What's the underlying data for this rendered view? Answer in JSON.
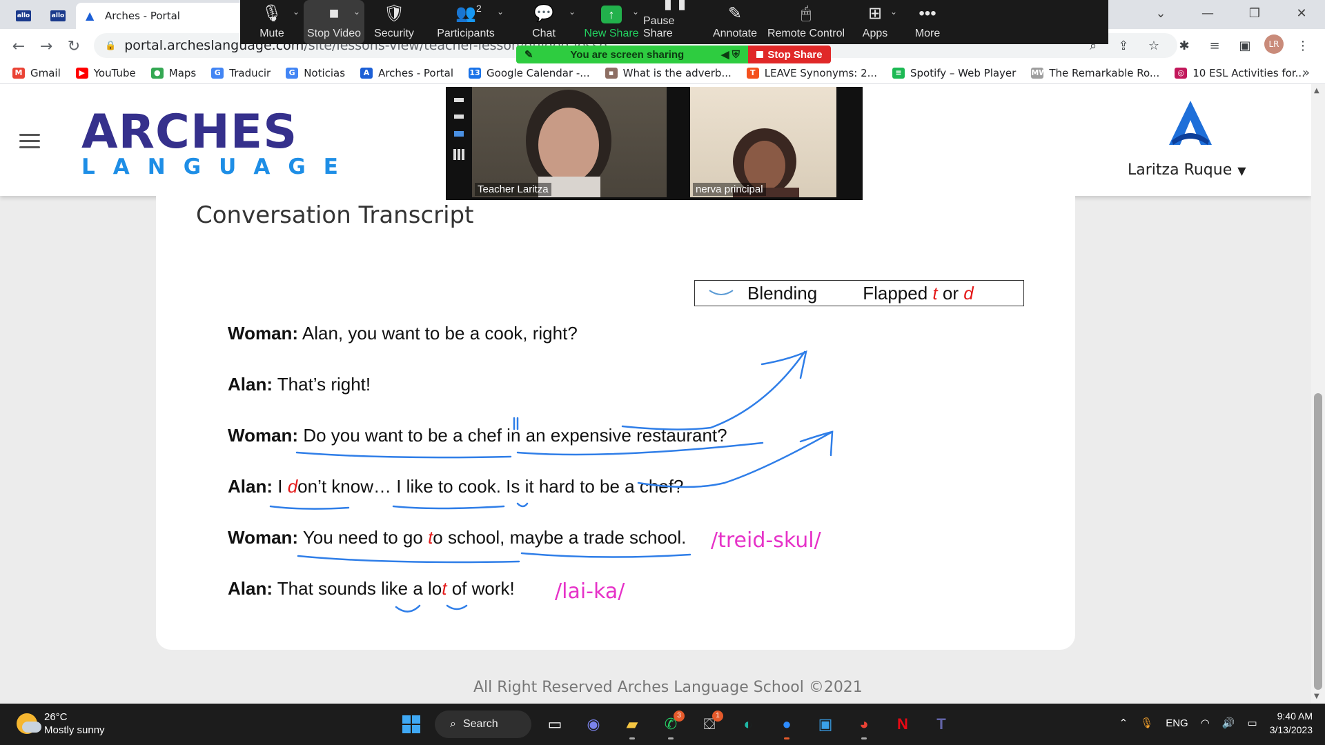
{
  "browser": {
    "tab_title": "Arches - Portal",
    "url_host": "portal.archeslanguage.com",
    "url_path": "/site/lessons-view/teacher-lesson/guided-lesso"
  },
  "bookmarks": [
    {
      "label": "Gmail",
      "color": "#ea4335",
      "glyph": "M"
    },
    {
      "label": "YouTube",
      "color": "#ff0000",
      "glyph": "▶"
    },
    {
      "label": "Maps",
      "color": "#34a853",
      "glyph": "●"
    },
    {
      "label": "Traducir",
      "color": "#4285f4",
      "glyph": "G"
    },
    {
      "label": "Noticias",
      "color": "#4285f4",
      "glyph": "G"
    },
    {
      "label": "Arches - Portal",
      "color": "#1c5fd6",
      "glyph": "A"
    },
    {
      "label": "Google Calendar -...",
      "color": "#1a73e8",
      "glyph": "13"
    },
    {
      "label": "What is the adverb...",
      "color": "#8d6e63",
      "glyph": "▪"
    },
    {
      "label": "LEAVE Synonyms: 2...",
      "color": "#f4511e",
      "glyph": "T"
    },
    {
      "label": "Spotify – Web Player",
      "color": "#1db954",
      "glyph": "≡"
    },
    {
      "label": "The Remarkable Ro...",
      "color": "#9e9e9e",
      "glyph": "MW"
    },
    {
      "label": "10 ESL Activities for...",
      "color": "#c2185b",
      "glyph": "◎"
    }
  ],
  "zoom": {
    "buttons": [
      {
        "label": "Mute",
        "icon": "🎙",
        "caret": true
      },
      {
        "label": "Stop Video",
        "icon": "■",
        "caret": true,
        "active": true
      },
      {
        "label": "Security",
        "icon": "🛡",
        "caret": false
      },
      {
        "label": "Participants",
        "icon": "👥",
        "caret": true,
        "badge": "2"
      },
      {
        "label": "Chat",
        "icon": "💬",
        "caret": true
      },
      {
        "label": "New Share",
        "icon": "↑",
        "caret": true,
        "green": true
      },
      {
        "label": "Pause Share",
        "icon": "❚❚",
        "caret": false
      },
      {
        "label": "Annotate",
        "icon": "✎",
        "caret": false
      },
      {
        "label": "Remote Control",
        "icon": "🖱",
        "caret": false
      },
      {
        "label": "Apps",
        "icon": "⊞",
        "caret": true
      },
      {
        "label": "More",
        "icon": "•••",
        "caret": false
      }
    ],
    "sharing_label": "You are screen sharing",
    "stop_share_label": "Stop Share",
    "participants": [
      {
        "name": "Teacher Laritza"
      },
      {
        "name": "nerva principal"
      }
    ]
  },
  "site": {
    "logo_top": "ARCHES",
    "logo_bottom": "LANGUAGE",
    "user_name": "Laritza Ruque",
    "section_title": "Conversation Transcript",
    "legend_blending": "Blending",
    "legend_flapped": "Flapped",
    "legend_t": "t",
    "legend_or": "or",
    "legend_d": "d",
    "footer": "All Right Reserved Arches Language School ©2021"
  },
  "transcript": [
    {
      "speaker": "Woman:",
      "text": "Alan, you want to be a cook, right?"
    },
    {
      "speaker": "Alan:",
      "text": "That’s right!"
    },
    {
      "speaker": "Woman:",
      "text": "Do you want to be a chef in an expensive restaurant?"
    },
    {
      "speaker": "Alan:",
      "text_pre": "I ",
      "flap": "d",
      "text_post": "on’t know… I like to cook. Is it hard to be a chef?"
    },
    {
      "speaker": "Woman:",
      "text_pre": "You need to go ",
      "flap": "t",
      "text_post": "o school, maybe a trade school."
    },
    {
      "speaker": "Alan:",
      "text_pre": "That sounds like a lo",
      "flap": "t",
      "text_post": " of work!"
    }
  ],
  "annotations": {
    "trade_school": "/treid-skul/",
    "like_a": "/lai-ka/"
  },
  "taskbar": {
    "temperature": "26°C",
    "weather": "Mostly sunny",
    "search_label": "Search",
    "language": "ENG",
    "time": "9:40 AM",
    "date": "3/13/2023",
    "whatsapp_badge": "3",
    "store_badge": "1"
  }
}
